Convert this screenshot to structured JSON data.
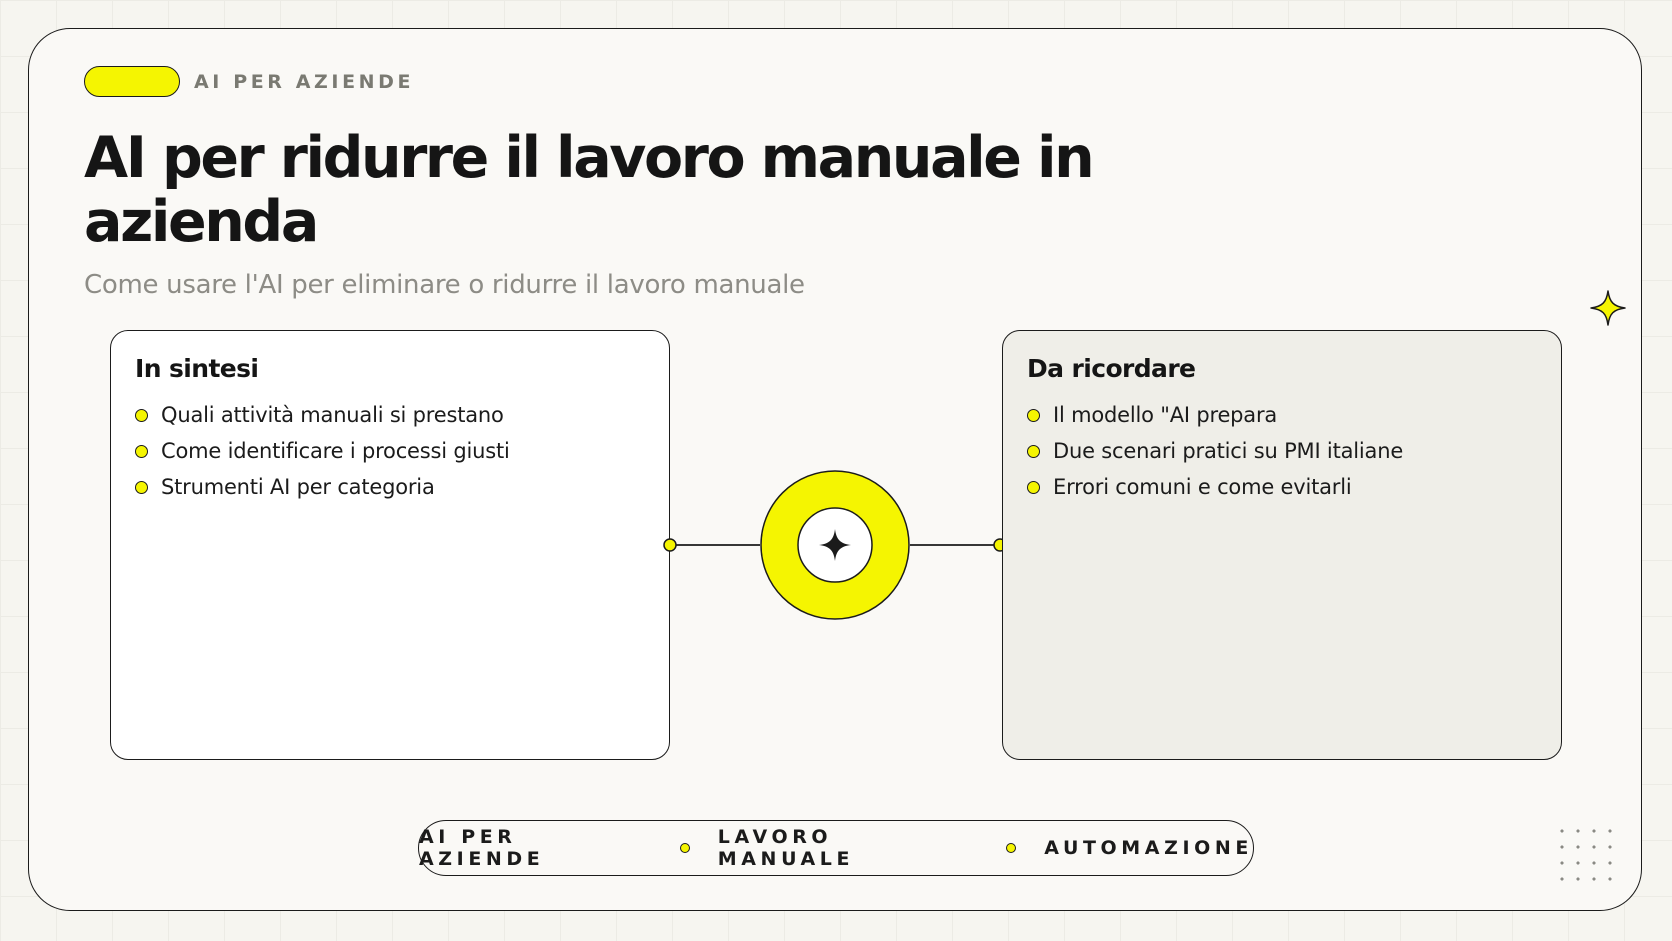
{
  "eyebrow": {
    "label": "AI PER AZIENDE"
  },
  "header": {
    "title": "AI per ridurre il lavoro manuale in azienda",
    "subtitle": "Come usare l'AI per eliminare o ridurre il lavoro manuale"
  },
  "left_card": {
    "title": "In sintesi",
    "items": [
      "Quali attività manuali si prestano",
      "Come identificare i processi giusti",
      "Strumenti AI per categoria"
    ]
  },
  "right_card": {
    "title": "Da ricordare",
    "items": [
      "Il modello \"AI prepara",
      "Due scenari pratici su PMI italiane",
      "Errori comuni e come evitarli"
    ]
  },
  "footer": {
    "tags": [
      "AI PER AZIENDE",
      "LAVORO MANUALE",
      "AUTOMAZIONE"
    ]
  },
  "colors": {
    "accent": "#f5f501",
    "ink": "#1b1b1b",
    "background": "#faf9f6",
    "muted_text": "#8d8c86"
  },
  "icons": {
    "sparkle": "four-point-star-icon",
    "hub": "four-point-star-icon"
  }
}
